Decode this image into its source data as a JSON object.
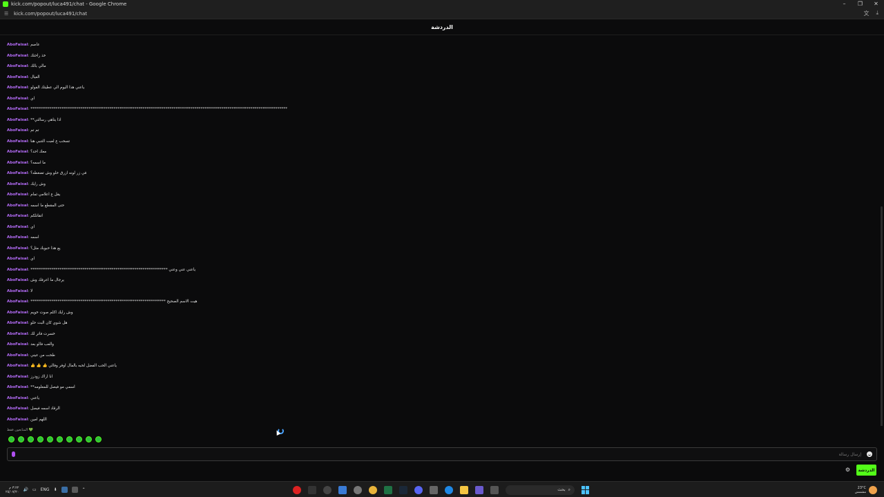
{
  "window": {
    "title": "kick.com/popout/luca491/chat - Google Chrome",
    "url": "kick.com/popout/luca491/chat",
    "controls": [
      "–",
      "❐",
      "✕"
    ]
  },
  "chat": {
    "header_title": "الدردشة",
    "messages": [
      {
        "user": "AboFaisal",
        "text": "عاصم"
      },
      {
        "user": "AboFaisal",
        "text": "خذ راحتك"
      },
      {
        "user": "AboFaisal",
        "text": "مالي بالك"
      },
      {
        "user": "AboFaisal",
        "text": "العيال"
      },
      {
        "user": "AboFaisal",
        "text": "ياعني هذا اليوم الي عطيتك الفولو"
      },
      {
        "user": "AboFaisal",
        "text": "اي"
      },
      {
        "user": "AboFaisal",
        "text": "*************************************************************************************************************************************"
      },
      {
        "user": "AboFaisal",
        "text": "**اذا يتاهي رسالتي"
      },
      {
        "user": "AboFaisal",
        "text": "تم تم"
      },
      {
        "user": "AboFaisal",
        "text": "تسحب ع لعبت التنبي هنا"
      },
      {
        "user": "AboFaisal",
        "text": "معك احد؟"
      },
      {
        "user": "AboFaisal",
        "text": "ما اسمه؟"
      },
      {
        "user": "AboFaisal",
        "text": "في زر لونه ازرق حلو وش تضغطه؟"
      },
      {
        "user": "AboFaisal",
        "text": "وش رايك"
      },
      {
        "user": "AboFaisal",
        "text": "يقل ع اعلامي تمام"
      },
      {
        "user": "AboFaisal",
        "text": "حتى المقطع ما اسمه"
      },
      {
        "user": "AboFaisal",
        "text": "اتقاتلكم"
      },
      {
        "user": "AboFaisal",
        "text": "اي"
      },
      {
        "user": "AboFaisal",
        "text": "اسمه"
      },
      {
        "user": "AboFaisal",
        "text": "يع هذا حبوبك مثل؟"
      },
      {
        "user": "AboFaisal",
        "text": "اي"
      },
      {
        "user": "AboFaisal",
        "text": "*********************************************************************** ياعني عني وعني"
      },
      {
        "user": "AboFaisal",
        "text": "يرجال ما اعرفك وش"
      },
      {
        "user": "AboFaisal",
        "text": "لا"
      },
      {
        "user": "AboFaisal",
        "text": "********************************************************************** هيت الاسم الصحيح"
      },
      {
        "user": "AboFaisal",
        "text": "وش رايك اكلم صوت خويم"
      },
      {
        "user": "AboFaisal",
        "text": "هل شوي كان البث حلو"
      },
      {
        "user": "AboFaisal",
        "text": "خسرت فاتر لك"
      },
      {
        "user": "AboFaisal",
        "text": "والعب فالو بعد"
      },
      {
        "user": "AboFaisal",
        "text": "طحت من عيني"
      },
      {
        "user": "AboFaisal",
        "text": "👍 👍 👍 ياعني الحب الفضل لحبه بالمال اوفر وفالي"
      },
      {
        "user": "AboFaisal",
        "text": "انا اراك زودرز"
      },
      {
        "user": "AboFaisal",
        "text": "**اسمي مو فيصل للمعلومه"
      },
      {
        "user": "AboFaisal",
        "text": "ياعني"
      },
      {
        "user": "AboFaisal",
        "text": "الرقاد اسمه فيصل"
      },
      {
        "user": "AboFaisal",
        "text": "اللهم امين"
      }
    ],
    "followers_note": "المتابعون فقط 💚",
    "emote_count": 10,
    "input_placeholder": "إرسال رسالة",
    "send_label": "الدردشة",
    "settings_icon": "⚙"
  },
  "taskbar": {
    "clock_time": "٣:٢٢ م",
    "clock_date": "٢٥/٠٧/٢٠",
    "language": "ENG",
    "search_label": "بحث",
    "weather_temp": "23°C",
    "weather_desc": "مشمس",
    "colors": {
      "kick_green": "#53fc18",
      "username_purple": "#b66dfa"
    }
  }
}
